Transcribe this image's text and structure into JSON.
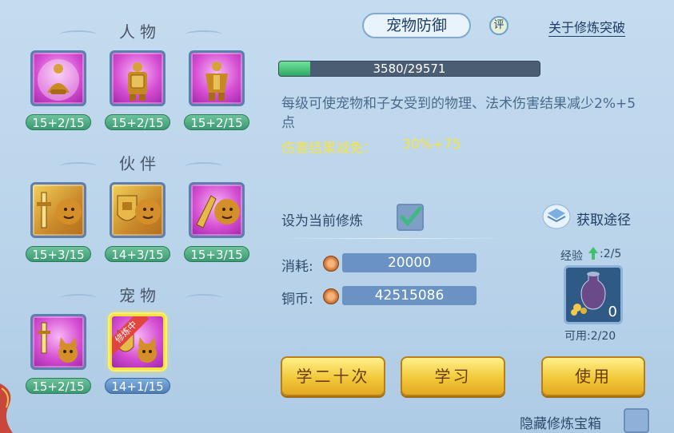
{
  "left": {
    "sections": [
      {
        "title": "人物",
        "tiles": [
          {
            "badge": "15+2/15",
            "icon": "meditating-figure-icon"
          },
          {
            "badge": "15+2/15",
            "icon": "shield-warrior-icon"
          },
          {
            "badge": "15+2/15",
            "icon": "armored-warrior-icon"
          }
        ]
      },
      {
        "title": "伙伴",
        "tiles": [
          {
            "badge": "15+3/15",
            "icon": "sword-lion-icon"
          },
          {
            "badge": "14+3/15",
            "icon": "shield-lion-icon"
          },
          {
            "badge": "15+3/15",
            "icon": "fist-lion-icon"
          }
        ]
      },
      {
        "title": "宠物",
        "tiles": [
          {
            "badge": "15+2/15",
            "icon": "sword-cat-icon"
          },
          {
            "badge": "14+1/15",
            "icon": "shield-cat-icon",
            "ribbon": "修炼中"
          }
        ]
      }
    ]
  },
  "right": {
    "title": "宠物防御",
    "eval_label": "评",
    "breakthrough_link": "关于修炼突破",
    "progress": {
      "text": "3580/29571",
      "current": 3580,
      "max": 29571
    },
    "description": "每级可使宠物和子女受到的物理、法术伤害结果减少2%+5点",
    "effect_label": "伤害结果减免：",
    "effect_value": "30%+75",
    "set_current_label": "设为当前修炼",
    "set_current_checked": true,
    "acquire_label": "获取途径",
    "cost_label": "消耗:",
    "cost_value": "20000",
    "copper_label": "铜币:",
    "copper_value": "42515086",
    "exp_label": "经验",
    "exp_count": ":2/5",
    "item_count": "0",
    "available": "可用:2/20",
    "buttons": {
      "learn20": "学二十次",
      "learn": "学习",
      "use": "使用"
    },
    "hide_chest_label": "隐藏修炼宝箱"
  },
  "colors": {
    "background": "#c5dcef",
    "accent_green": "#3a9a72",
    "effect_yellow": "#f4e24a",
    "button_gold": "#f2c93a"
  }
}
